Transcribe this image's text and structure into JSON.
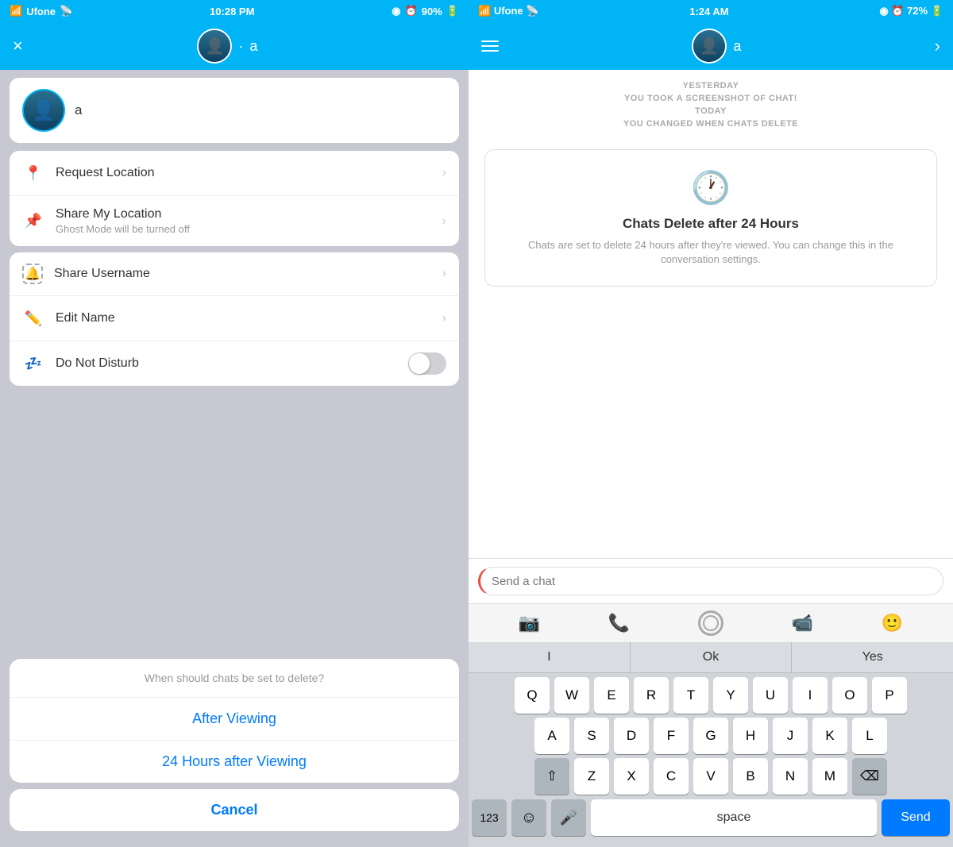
{
  "left": {
    "statusBar": {
      "carrier": "Ufone",
      "time": "10:28 PM",
      "battery": "90%"
    },
    "header": {
      "close": "×",
      "username": "a"
    },
    "profile": {
      "name": "a",
      "sublabel": "·|"
    },
    "settings": [
      {
        "id": "request-location",
        "icon": "📍",
        "label": "Request Location",
        "sublabel": "",
        "type": "chevron"
      },
      {
        "id": "share-location",
        "icon": "📌",
        "label": "Share My Location",
        "sublabel": "Ghost Mode will be turned off",
        "type": "chevron"
      }
    ],
    "settings2": [
      {
        "id": "share-username",
        "icon": "🔔",
        "label": "Share Username",
        "sublabel": "",
        "type": "chevron"
      },
      {
        "id": "edit-name",
        "icon": "✏️",
        "label": "Edit Name",
        "sublabel": "",
        "type": "chevron"
      },
      {
        "id": "do-not-disturb",
        "icon": "💤",
        "label": "Do Not Disturb",
        "sublabel": "",
        "type": "toggle"
      }
    ],
    "actionSheet": {
      "title": "When should chats be set to delete?",
      "options": [
        "After Viewing",
        "24 Hours after Viewing"
      ],
      "cancel": "Cancel"
    }
  },
  "right": {
    "statusBar": {
      "carrier": "Ufone",
      "time": "1:24 AM",
      "battery": "72%"
    },
    "header": {
      "username": "a"
    },
    "notifications": [
      "YESTERDAY",
      "YOU TOOK A SCREENSHOT OF CHAT!",
      "TODAY",
      "YOU CHANGED WHEN CHATS DELETE"
    ],
    "deleteCard": {
      "title": "Chats Delete after 24 Hours",
      "description": "Chats are set to delete 24 hours after they're viewed. You can change this in the conversation settings."
    },
    "input": {
      "placeholder": "Send a chat"
    },
    "keyboard": {
      "suggestions": [
        "I",
        "Ok",
        "Yes"
      ],
      "rows": [
        [
          "Q",
          "W",
          "E",
          "R",
          "T",
          "Y",
          "U",
          "I",
          "O",
          "P"
        ],
        [
          "A",
          "S",
          "D",
          "F",
          "G",
          "H",
          "J",
          "K",
          "L"
        ],
        [
          "Z",
          "X",
          "C",
          "V",
          "B",
          "N",
          "M"
        ]
      ],
      "space": "space",
      "send": "Send",
      "num": "123"
    }
  }
}
